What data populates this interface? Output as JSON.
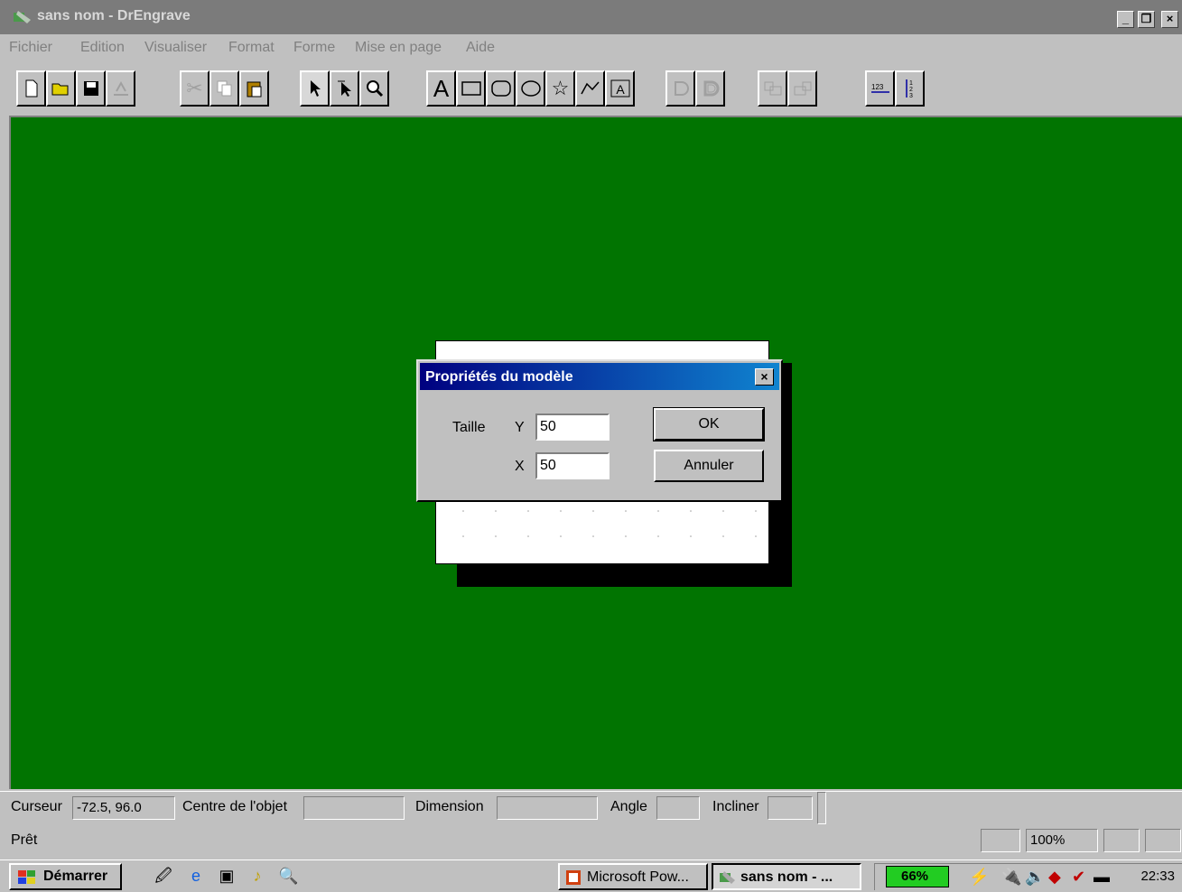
{
  "window": {
    "title": "sans nom - DrEngrave",
    "controls": {
      "minimize": "_",
      "restore": "❐",
      "close": "×"
    }
  },
  "menu": [
    "Fichier",
    "Edition",
    "Visualiser",
    "Format",
    "Forme",
    "Mise en page",
    "Aide"
  ],
  "toolbar": {
    "text_tool": "A"
  },
  "dialog": {
    "title": "Propriétés du modèle",
    "size_label": "Taille",
    "y_label": "Y",
    "y_value": "50",
    "x_label": "X",
    "x_value": "50",
    "ok": "OK",
    "cancel": "Annuler"
  },
  "status": {
    "cursor_label": "Curseur",
    "cursor_value": "-72.5, 96.0",
    "center_label": "Centre de l'objet",
    "center_value": "",
    "dimension_label": "Dimension",
    "dimension_value": "",
    "angle_label": "Angle",
    "angle_value": "",
    "skew_label": "Incliner",
    "skew_value": "",
    "ready": "Prêt",
    "zoom": "100%"
  },
  "taskbar": {
    "start": "Démarrer",
    "tasks": [
      "Microsoft Pow...",
      "sans nom - ..."
    ],
    "battery": "66%",
    "clock": "22:33"
  },
  "colors": {
    "canvas": "#017401",
    "dialog_title": "#000080",
    "battery": "#22cc22"
  }
}
